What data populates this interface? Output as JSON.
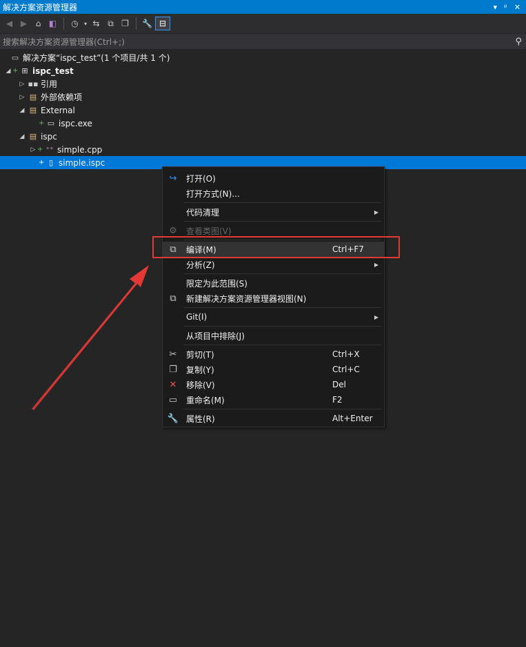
{
  "panel": {
    "title": "解决方案资源管理器",
    "title_controls": [
      "▾",
      "ᵖ",
      "✕"
    ]
  },
  "search": {
    "placeholder": "搜索解决方案资源管理器(Ctrl+;)"
  },
  "tree": {
    "solution": "解决方案“ispc_test”(1 个项目/共 1 个)",
    "project": "ispc_test",
    "references": "引用",
    "external_deps": "外部依赖项",
    "external": "External",
    "ispc_exe": "ispc.exe",
    "ispc_folder": "ispc",
    "simple_cpp": "simple.cpp",
    "simple_ispc": "simple.ispc"
  },
  "context_menu": {
    "open": "打开(O)",
    "open_with": "打开方式(N)...",
    "code_cleanup": "代码清理",
    "view_class_diagram": "查看类图(V)",
    "compile": "编译(M)",
    "compile_shortcut": "Ctrl+F7",
    "analyze": "分析(Z)",
    "scope_to_this": "限定为此范围(S)",
    "new_view": "新建解决方案资源管理器视图(N)",
    "git": "Git(I)",
    "exclude": "从项目中排除(J)",
    "cut": "剪切(T)",
    "cut_shortcut": "Ctrl+X",
    "copy": "复制(Y)",
    "copy_shortcut": "Ctrl+C",
    "remove": "移除(V)",
    "remove_shortcut": "Del",
    "rename": "重命名(M)",
    "rename_shortcut": "F2",
    "properties": "属性(R)",
    "properties_shortcut": "Alt+Enter"
  },
  "colors": {
    "accent": "#007acc",
    "selection": "#0078d7",
    "annotation": "#e53935"
  }
}
